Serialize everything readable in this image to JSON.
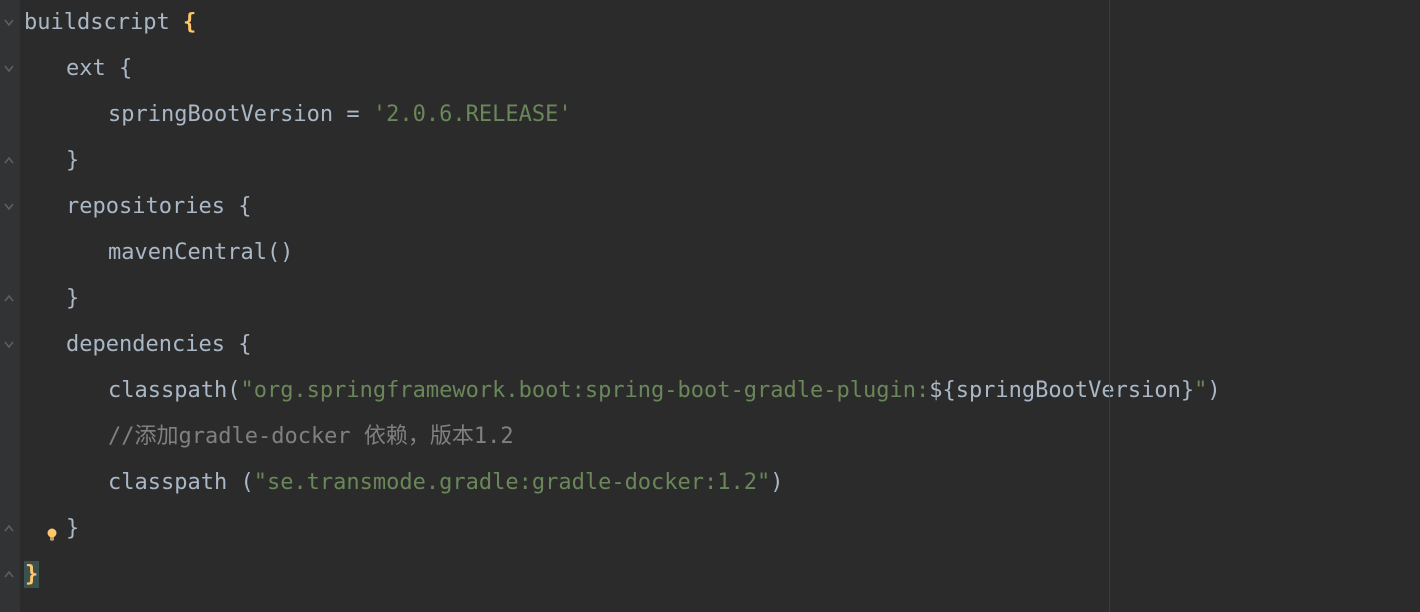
{
  "code": {
    "line1": {
      "keyword": "buildscript ",
      "brace": "{"
    },
    "line2": {
      "keyword": "ext ",
      "brace": "{"
    },
    "line3": {
      "identifier": "springBootVersion ",
      "operator": "= ",
      "string": "'2.0.6.RELEASE'"
    },
    "line4": {
      "brace": "}"
    },
    "line5": {
      "keyword": "repositories ",
      "brace": "{"
    },
    "line6": {
      "text": "mavenCentral()"
    },
    "line7": {
      "brace": "}"
    },
    "line8": {
      "keyword": "dependencies ",
      "brace": "{"
    },
    "line9": {
      "text1": "classpath(",
      "string1": "\"org.springframework.boot:spring-boot-gradle-plugin:",
      "interp": "${springBootVersion}",
      "string2": "\"",
      "text2": ")"
    },
    "line10": {
      "comment": "//添加gradle-docker 依赖，版本1.2"
    },
    "line11": {
      "text1": "classpath (",
      "string": "\"se.transmode.gradle:gradle-docker:1.2\"",
      "text2": ")"
    },
    "line12": {
      "brace": "}"
    },
    "line13": {
      "brace": "}"
    }
  }
}
